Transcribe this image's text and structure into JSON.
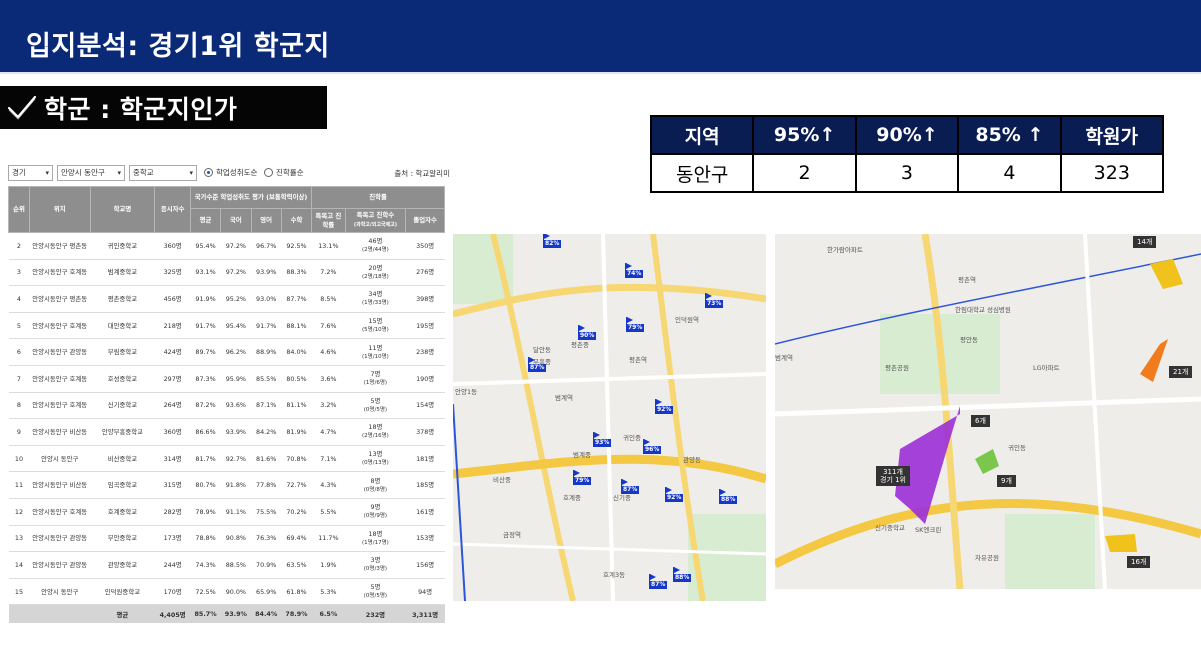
{
  "header": {
    "title": "입지분석: 경기1위 학군지"
  },
  "section": {
    "label": "학군 : 학군지인가",
    "icon": "check-icon"
  },
  "summary_table": {
    "headers": [
      "지역",
      "95%↑",
      "90%↑",
      "85% ↑",
      "학원가"
    ],
    "row": [
      "동안구",
      "2",
      "3",
      "4",
      "323"
    ]
  },
  "filters": {
    "region": "경기",
    "district": "안양시 동안구",
    "level": "중학교",
    "radio1": "학업성취도순",
    "radio2": "진학률순",
    "source": "출처 : 학교알리미"
  },
  "school_table": {
    "headers": {
      "rank": "순위",
      "location": "위치",
      "name": "학교명",
      "applicants": "응시자수",
      "national_group": "국가수준 학업성취도 평가 (보통학력이상)",
      "avg": "평균",
      "korean": "국어",
      "english": "영어",
      "math": "수학",
      "admission_group": "진학률",
      "special_rate": "특목고 진학률",
      "special_count": "특목고 진학수",
      "special_count_sub": "(과학고/외고국제고)",
      "graduates": "졸업자수"
    },
    "rows": [
      {
        "rank": "2",
        "location": "안양시동안구 평촌동",
        "name": "귀인중학교",
        "applicants": "360명",
        "avg": "95.4%",
        "korean": "97.2%",
        "english": "96.7%",
        "math": "92.5%",
        "special_rate": "13.1%",
        "special_count": "46명",
        "special_detail": "(2명/44명)",
        "graduates": "350명"
      },
      {
        "rank": "3",
        "location": "안양시동안구 호계동",
        "name": "범계중학교",
        "applicants": "325명",
        "avg": "93.1%",
        "korean": "97.2%",
        "english": "93.9%",
        "math": "88.3%",
        "special_rate": "7.2%",
        "special_count": "20명",
        "special_detail": "(2명/18명)",
        "graduates": "276명"
      },
      {
        "rank": "4",
        "location": "안양시동안구 평촌동",
        "name": "평촌중학교",
        "applicants": "456명",
        "avg": "91.9%",
        "korean": "95.2%",
        "english": "93.0%",
        "math": "87.7%",
        "special_rate": "8.5%",
        "special_count": "34명",
        "special_detail": "(1명/33명)",
        "graduates": "398명"
      },
      {
        "rank": "5",
        "location": "안양시동안구 호계동",
        "name": "대안중학교",
        "applicants": "218명",
        "avg": "91.7%",
        "korean": "95.4%",
        "english": "91.7%",
        "math": "88.1%",
        "special_rate": "7.6%",
        "special_count": "15명",
        "special_detail": "(5명/10명)",
        "graduates": "195명"
      },
      {
        "rank": "6",
        "location": "안양시동안구 관양동",
        "name": "부림중학교",
        "applicants": "424명",
        "avg": "89.7%",
        "korean": "96.2%",
        "english": "88.9%",
        "math": "84.0%",
        "special_rate": "4.6%",
        "special_count": "11명",
        "special_detail": "(1명/10명)",
        "graduates": "238명"
      },
      {
        "rank": "7",
        "location": "안양시동안구 호계동",
        "name": "호성중학교",
        "applicants": "297명",
        "avg": "87.3%",
        "korean": "95.9%",
        "english": "85.5%",
        "math": "80.5%",
        "special_rate": "3.6%",
        "special_count": "7명",
        "special_detail": "(1명/6명)",
        "graduates": "190명"
      },
      {
        "rank": "8",
        "location": "안양시동안구 호계동",
        "name": "신기중학교",
        "applicants": "264명",
        "avg": "87.2%",
        "korean": "93.6%",
        "english": "87.1%",
        "math": "81.1%",
        "special_rate": "3.2%",
        "special_count": "5명",
        "special_detail": "(0명/5명)",
        "graduates": "154명"
      },
      {
        "rank": "9",
        "location": "안양시동안구 비산동",
        "name": "안양부흥중학교",
        "applicants": "360명",
        "avg": "86.6%",
        "korean": "93.9%",
        "english": "84.2%",
        "math": "81.9%",
        "special_rate": "4.7%",
        "special_count": "18명",
        "special_detail": "(2명/16명)",
        "graduates": "378명"
      },
      {
        "rank": "10",
        "location": "안양시 동안구",
        "name": "비산중학교",
        "applicants": "314명",
        "avg": "81.7%",
        "korean": "92.7%",
        "english": "81.6%",
        "math": "70.8%",
        "special_rate": "7.1%",
        "special_count": "13명",
        "special_detail": "(0명/13명)",
        "graduates": "181명"
      },
      {
        "rank": "11",
        "location": "안양시동안구 비산동",
        "name": "임곡중학교",
        "applicants": "315명",
        "avg": "80.7%",
        "korean": "91.8%",
        "english": "77.8%",
        "math": "72.7%",
        "special_rate": "4.3%",
        "special_count": "8명",
        "special_detail": "(0명/8명)",
        "graduates": "185명"
      },
      {
        "rank": "12",
        "location": "안양시동안구 호계동",
        "name": "호계중학교",
        "applicants": "282명",
        "avg": "78.9%",
        "korean": "91.1%",
        "english": "75.5%",
        "math": "70.2%",
        "special_rate": "5.5%",
        "special_count": "9명",
        "special_detail": "(0명/9명)",
        "graduates": "161명"
      },
      {
        "rank": "13",
        "location": "안양시동안구 관양동",
        "name": "부안중학교",
        "applicants": "173명",
        "avg": "78.8%",
        "korean": "90.8%",
        "english": "76.3%",
        "math": "69.4%",
        "special_rate": "11.7%",
        "special_count": "18명",
        "special_detail": "(1명/17명)",
        "graduates": "153명"
      },
      {
        "rank": "14",
        "location": "안양시동안구 관양동",
        "name": "관양중학교",
        "applicants": "244명",
        "avg": "74.3%",
        "korean": "88.5%",
        "english": "70.9%",
        "math": "63.5%",
        "special_rate": "1.9%",
        "special_count": "3명",
        "special_detail": "(0명/3명)",
        "graduates": "156명"
      },
      {
        "rank": "15",
        "location": "안양시 동안구",
        "name": "인덕원중학교",
        "applicants": "170명",
        "avg": "72.5%",
        "korean": "90.0%",
        "english": "65.9%",
        "math": "61.8%",
        "special_rate": "5.3%",
        "special_count": "5명",
        "special_detail": "(0명/5명)",
        "graduates": "94명"
      }
    ],
    "footer": {
      "label": "평균",
      "applicants": "4,405명",
      "avg": "85.7%",
      "korean": "93.9%",
      "english": "84.4%",
      "math": "78.9%",
      "special_rate": "6.5%",
      "special_count": "232명",
      "graduates": "3,311명"
    }
  },
  "map1": {
    "flags": [
      "82%",
      "74%",
      "73%",
      "90%",
      "79%",
      "87%",
      "92%",
      "93%",
      "96%",
      "79%",
      "87%",
      "92%",
      "88%",
      "87%",
      "88%"
    ],
    "labels": [
      "범계역",
      "평촌역",
      "안양1동",
      "호계3동",
      "금정역",
      "신기중",
      "인덕원역",
      "달안동",
      "부흥중",
      "범계중",
      "평촌중",
      "귀인중",
      "관양동",
      "호계중",
      "비산중"
    ]
  },
  "map2": {
    "badges": [
      "311개\n경기 1위",
      "6개",
      "9개",
      "14개",
      "21개",
      "16개"
    ],
    "labels": [
      "평촌역",
      "평안동",
      "귀인동",
      "한림대학교 성심병원",
      "SK엔크린",
      "신기중학교",
      "자유공원",
      "LG아파트",
      "평촌공원",
      "한가람아파트",
      "범계역"
    ]
  }
}
